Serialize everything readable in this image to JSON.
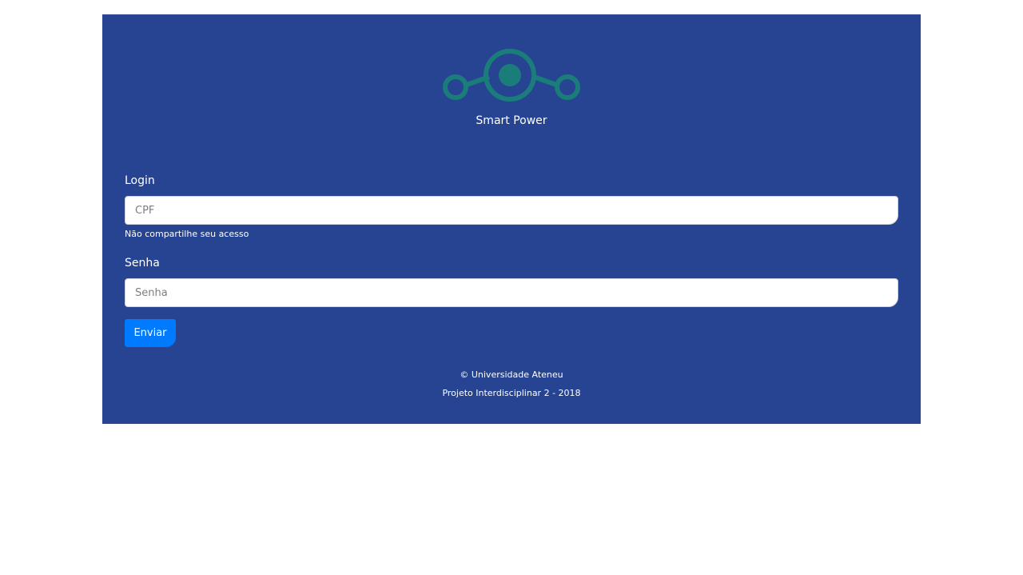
{
  "brand": {
    "logo_icon": "node-link-logo-icon",
    "logo_color": "#1a7d7a",
    "name": "Smart Power"
  },
  "form": {
    "login_label": "Login",
    "login_placeholder": "CPF",
    "login_value": "",
    "login_help": "Não compartilhe seu acesso",
    "password_label": "Senha",
    "password_placeholder": "Senha",
    "password_value": "",
    "submit_label": "Enviar"
  },
  "footer": {
    "copyright": "© Universidade Ateneu",
    "project": "Projeto Interdisciplinar 2 - 2018"
  },
  "colors": {
    "panel_background": "#264491",
    "button_primary": "#007bff",
    "page_background": "#ffffff"
  }
}
